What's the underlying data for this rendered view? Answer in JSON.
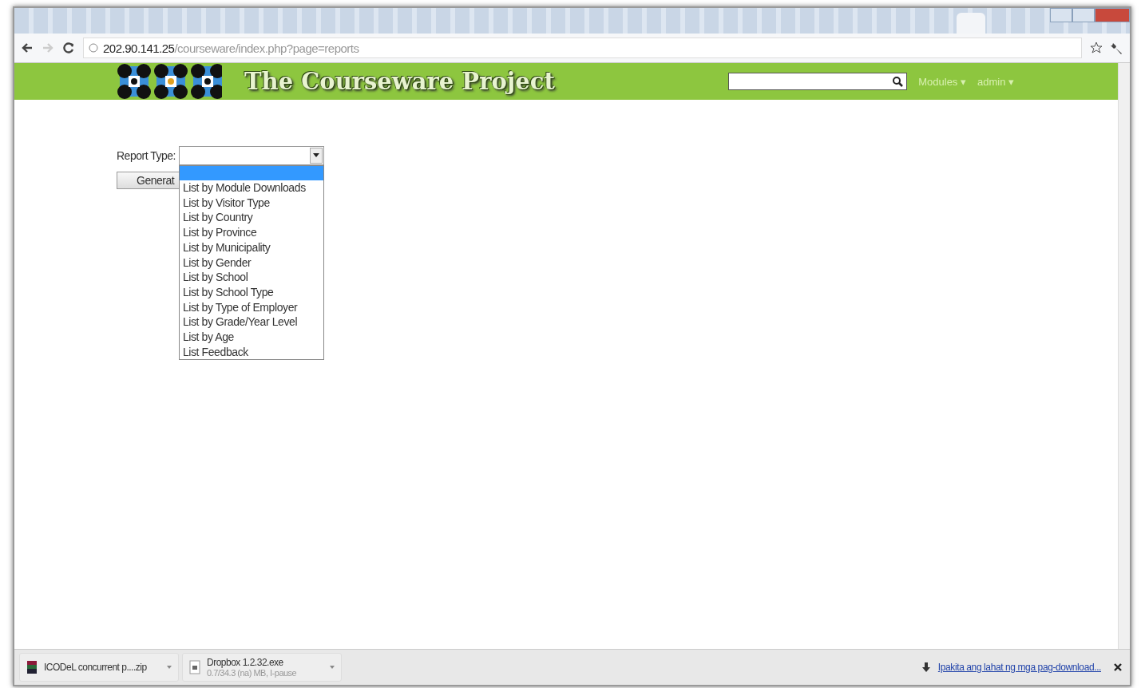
{
  "address_bar": {
    "host": "202.90.141.25",
    "path": "/courseware/index.php?page=reports"
  },
  "header": {
    "title": "The Courseware Project",
    "menus": [
      "Modules ▾",
      "admin ▾"
    ]
  },
  "report_form": {
    "label": "Report Type:",
    "button": "Generat",
    "dropdown": {
      "open": true,
      "blank_option_selected": true,
      "options": [
        {
          "label": "List by Module Downloads",
          "selected": false
        },
        {
          "label": "List by Visitor Type",
          "selected": false
        },
        {
          "label": "List by Country",
          "selected": false
        },
        {
          "label": "List by Province",
          "selected": false
        },
        {
          "label": "List by Municipality",
          "selected": false
        },
        {
          "label": "List by Gender",
          "selected": false
        },
        {
          "label": "List by School",
          "selected": false
        },
        {
          "label": "List by School Type",
          "selected": false
        },
        {
          "label": "List by Type of Employer",
          "selected": false
        },
        {
          "label": "List by Grade/Year Level",
          "selected": false
        },
        {
          "label": "List by Age",
          "selected": false
        },
        {
          "label": "List Feedback",
          "selected": false
        }
      ]
    }
  },
  "downloads": [
    {
      "kind": "archive",
      "name": "ICODeL concurrent p....zip"
    },
    {
      "kind": "installer",
      "name": "Dropbox 1.2.32.exe",
      "status": "0.7/34.3 (na) MB, I-pause"
    }
  ],
  "show_all_link": "Ipakita ang lahat ng mga pag-download..."
}
